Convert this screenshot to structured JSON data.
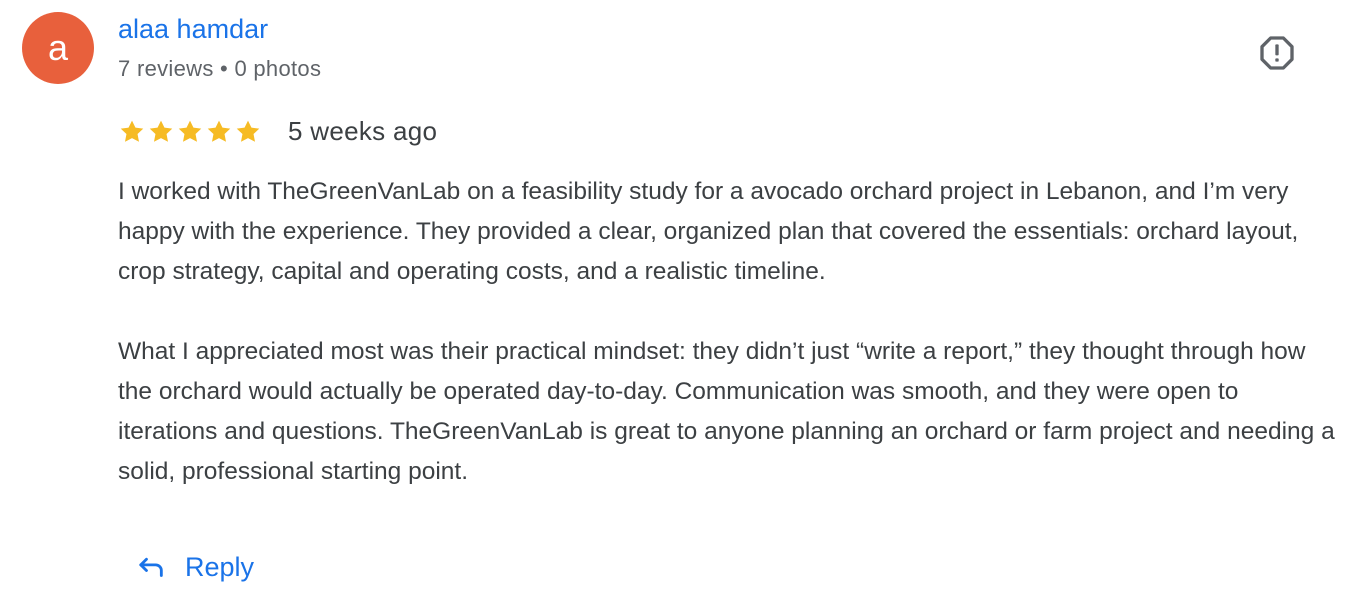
{
  "review": {
    "author": {
      "avatar_letter": "a",
      "avatar_color": "#e8603c",
      "name": "alaa hamdar",
      "meta": "7 reviews • 0 photos"
    },
    "rating": 5,
    "rating_max": 5,
    "star_color": "#f6bb24",
    "date": "5 weeks ago",
    "paragraphs": [
      "I worked with TheGreenVanLab on a feasibility study for a avocado orchard project in Lebanon, and I’m very happy with the experience. They provided a clear, organized plan that covered the essentials: orchard layout, crop strategy, capital and operating costs, and a realistic timeline.",
      "What I appreciated most was their practical mindset: they didn’t just “write a report,” they thought through how the orchard would actually be operated day-to-day. Communication was smooth, and they were open to iterations and questions. TheGreenVanLab is great to anyone planning an orchard or farm project and needing a solid, professional starting point."
    ],
    "report_icon": "report-flag-octagon-icon",
    "reply": {
      "label": "Reply",
      "icon": "reply-arrow-icon"
    }
  },
  "colors": {
    "link_blue": "#1a73e8",
    "text": "#3c4043",
    "secondary_text": "#5f6368"
  }
}
